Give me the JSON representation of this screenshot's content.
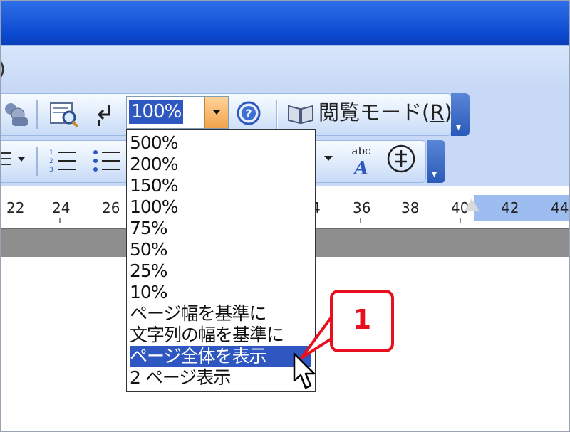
{
  "menubar": {
    "fragment": ")"
  },
  "toolbar": {
    "zoom_value": "100%",
    "reading_mode": {
      "label_main": "閲覧モード(",
      "hotkey": "R",
      "label_end": ")"
    },
    "icons": [
      "people-icon",
      "print-preview-icon",
      "arrow-icon",
      "help-icon",
      "book-icon",
      "list-dropdown-icon",
      "numbered-list-icon",
      "bullet-list-icon",
      "dropdown-icon",
      "phonetic-guide-icon",
      "enclosed-character-icon"
    ]
  },
  "ruler": {
    "labels": [
      "22",
      "24",
      "26",
      "4",
      "36",
      "38",
      "40",
      "42",
      "44"
    ]
  },
  "zoom_dropdown": {
    "options": [
      "500%",
      "200%",
      "150%",
      "100%",
      "75%",
      "50%",
      "25%",
      "10%",
      "ページ幅を基準に",
      "文字列の幅を基準に",
      "ページ全体を表示",
      "2 ページ表示"
    ],
    "selected_index": 10
  },
  "callout": {
    "label": "1",
    "color": "#e8101f"
  },
  "colors": {
    "titlebar": "#0c49d1",
    "selection": "#2f57c1",
    "toolbar": "#c7d9f6"
  }
}
